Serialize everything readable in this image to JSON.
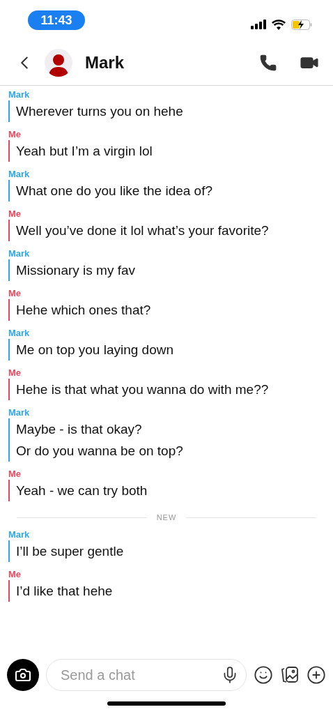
{
  "status_bar": {
    "time": "11:43"
  },
  "header": {
    "contact_name": "Mark"
  },
  "messages": [
    {
      "kind": "them",
      "sender": "Mark",
      "lines": [
        "Wherever turns you on hehe"
      ]
    },
    {
      "kind": "me",
      "sender": "Me",
      "lines": [
        "Yeah but I’m a virgin lol"
      ]
    },
    {
      "kind": "them",
      "sender": "Mark",
      "lines": [
        "What one do you like the idea of?"
      ]
    },
    {
      "kind": "me",
      "sender": "Me",
      "lines": [
        "Well you’ve done it lol what’s your favorite?"
      ]
    },
    {
      "kind": "them",
      "sender": "Mark",
      "lines": [
        "Missionary is my fav"
      ]
    },
    {
      "kind": "me",
      "sender": "Me",
      "lines": [
        "Hehe which ones that?"
      ]
    },
    {
      "kind": "them",
      "sender": "Mark",
      "lines": [
        "Me on top you laying down"
      ]
    },
    {
      "kind": "me",
      "sender": "Me",
      "lines": [
        "Hehe is that what you wanna do with me??"
      ]
    },
    {
      "kind": "them",
      "sender": "Mark",
      "lines": [
        "Maybe - is that okay?",
        "Or do you wanna be on top?"
      ]
    },
    {
      "kind": "me",
      "sender": "Me",
      "lines": [
        "Yeah - we can try both"
      ]
    },
    {
      "kind": "divider",
      "label": "NEW"
    },
    {
      "kind": "them",
      "sender": "Mark",
      "lines": [
        "I’ll be super gentle"
      ]
    },
    {
      "kind": "me",
      "sender": "Me",
      "lines": [
        "I’d like that hehe"
      ]
    }
  ],
  "composer": {
    "placeholder": "Send a chat"
  }
}
